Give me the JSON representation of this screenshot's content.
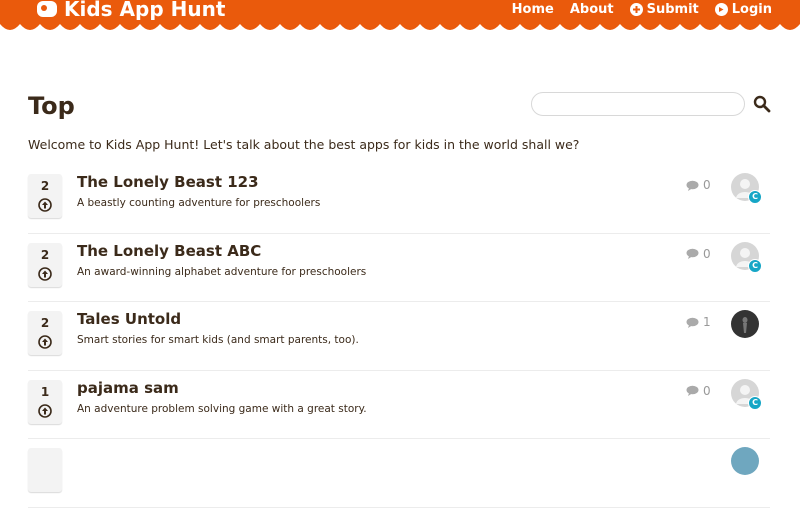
{
  "header": {
    "brand": "Kids App Hunt",
    "nav": [
      {
        "label": "Home"
      },
      {
        "label": "About"
      },
      {
        "label": "Submit",
        "icon": "plus-circle-icon"
      },
      {
        "label": "Login",
        "icon": "login-arrow-icon"
      }
    ],
    "color": "#ea5a0c"
  },
  "main": {
    "title": "Top",
    "search": {
      "placeholder": "",
      "value": ""
    },
    "welcome": "Welcome to Kids App Hunt! Let's talk about the best apps for kids in the world shall we?"
  },
  "posts": [
    {
      "votes": "2",
      "title": "The Lonely Beast 123",
      "tagline": "A beastly counting adventure for preschoolers",
      "comments": "0",
      "badge": "C"
    },
    {
      "votes": "2",
      "title": "The Lonely Beast ABC",
      "tagline": "An award-winning alphabet adventure for preschoolers",
      "comments": "0",
      "badge": "C"
    },
    {
      "votes": "2",
      "title": "Tales Untold",
      "tagline": "Smart stories for smart kids (and smart parents, too).",
      "comments": "1",
      "badge": ""
    },
    {
      "votes": "1",
      "title": "pajama sam",
      "tagline": "An adventure problem solving game with a great story.",
      "comments": "0",
      "badge": "C"
    },
    {
      "votes": "",
      "title": "",
      "tagline": "",
      "comments": "",
      "badge": ""
    }
  ]
}
